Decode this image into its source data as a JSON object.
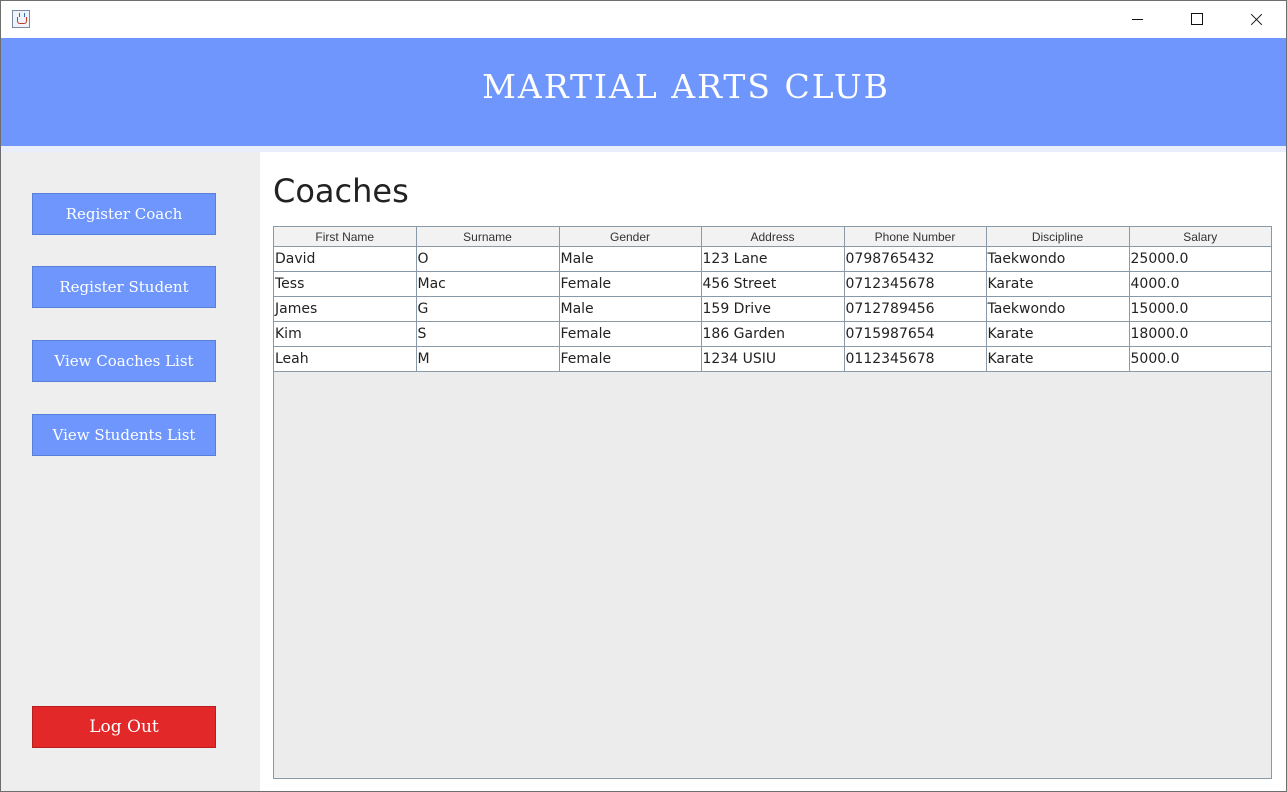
{
  "window": {
    "controls": [
      "minimize-icon",
      "maximize-icon",
      "close-icon"
    ],
    "icon": "java-cup-icon"
  },
  "header": {
    "title": "MARTIAL ARTS CLUB",
    "background": "#6e96fd"
  },
  "sidebar": {
    "buttons": [
      {
        "label": "Register Coach"
      },
      {
        "label": "Register Student"
      },
      {
        "label": "View Coaches List"
      },
      {
        "label": "View Students List"
      }
    ],
    "logout_label": "Log Out",
    "logout_color": "#e3282a"
  },
  "main": {
    "heading": "Coaches",
    "table": {
      "columns": [
        "First Name",
        "Surname",
        "Gender",
        "Address",
        "Phone Number",
        "Discipline",
        "Salary"
      ],
      "rows": [
        [
          "David",
          "O",
          "Male",
          "123 Lane",
          "0798765432",
          "Taekwondo",
          "25000.0"
        ],
        [
          "Tess",
          "Mac",
          "Female",
          "456 Street",
          "0712345678",
          "Karate",
          "4000.0"
        ],
        [
          "James",
          "G",
          "Male",
          "159 Drive",
          "0712789456",
          "Taekwondo",
          "15000.0"
        ],
        [
          "Kim",
          "S",
          "Female",
          "186 Garden",
          "0715987654",
          "Karate",
          "18000.0"
        ],
        [
          "Leah",
          "M",
          "Female",
          "1234 USIU",
          "0112345678",
          "Karate",
          "5000.0"
        ]
      ]
    }
  }
}
